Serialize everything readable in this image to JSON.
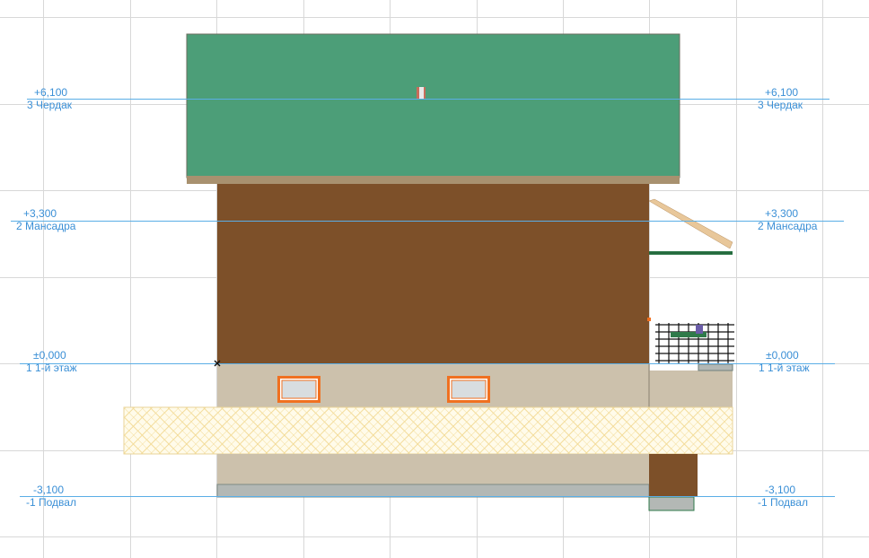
{
  "colors": {
    "grid": "#d8d8d8",
    "level_line": "#5aaee6",
    "level_text": "#3a8fd6",
    "roof": "#4c9e78",
    "roof_edge": "#a8916f",
    "wall_wood": "#7d5029",
    "plinth": "#ccc1ac",
    "ground_hatch": "#f3dc9a",
    "ground_fill": "#fffbea",
    "window_frame": "#f07020",
    "window_glass": "#d8dde0",
    "foundation": "#b3b8b5",
    "railing": "#1f6b3a",
    "rafter": "#e8c79a"
  },
  "levels": [
    {
      "value": "+6,100",
      "name": "3 Чердак"
    },
    {
      "value": "+3,300",
      "name": "2 Мансадра"
    },
    {
      "value": "±0,000",
      "name": "1 1-й этаж"
    },
    {
      "value": "-3,100",
      "name": "-1 Подвал"
    }
  ],
  "icons": {
    "origin_marker": "cross-icon"
  }
}
